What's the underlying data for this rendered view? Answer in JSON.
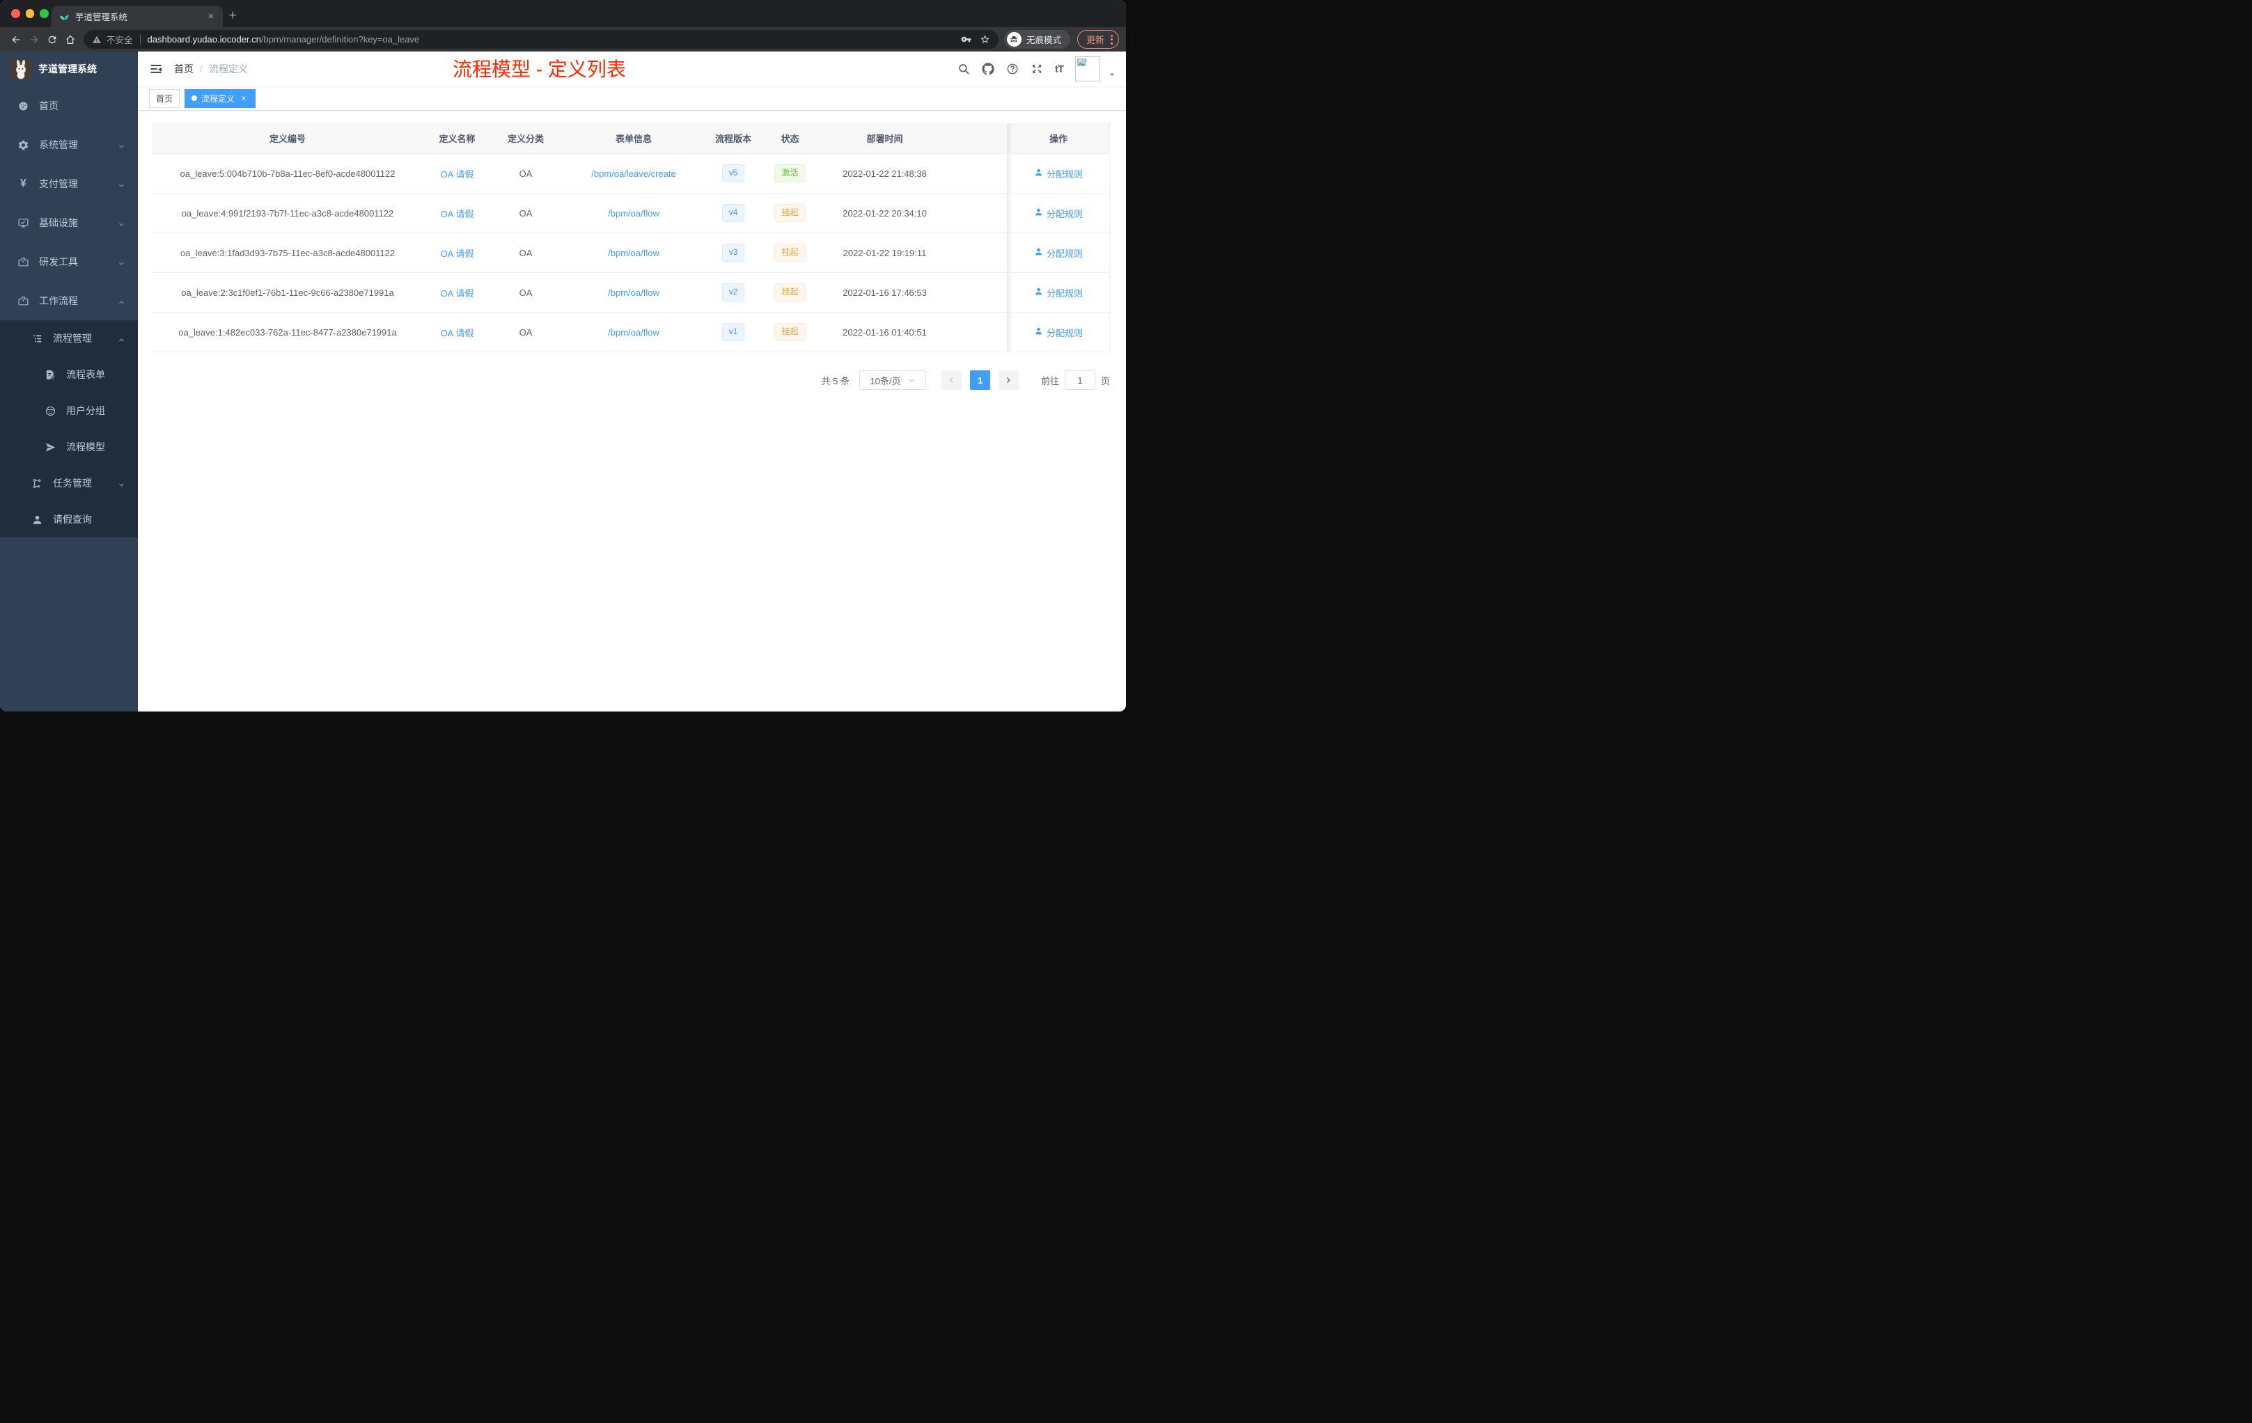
{
  "colors": {
    "accent": "#409eff",
    "annotation_red": "#ff2b00",
    "sidebar_bg": "#304156",
    "submenu_bg": "#1f2d3d",
    "status_active": {
      "bg": "#f0f9eb",
      "text": "#67c23a"
    },
    "status_suspended": {
      "bg": "#fdf6ec",
      "text": "#e6a23c"
    },
    "version_badge": {
      "bg": "#ecf5ff",
      "text": "#409eff"
    }
  },
  "glyphs": {
    "close": "×",
    "new_tab": "+",
    "breadcrumb_sep": "/",
    "font_size_icon": "tT"
  },
  "browser": {
    "tab_title": "芋道管理系统",
    "security_label": "不安全",
    "url_host": "dashboard.yudao.iocoder.cn",
    "url_path": "/bpm/manager/definition?key=oa_leave",
    "incognito_label": "无痕模式",
    "update_label": "更新"
  },
  "sidebar": {
    "logo_title": "芋道管理系统",
    "menu": [
      {
        "key": "home",
        "label": "首页",
        "icon": "dashboard-icon",
        "chevron": null,
        "level": 0
      },
      {
        "key": "system",
        "label": "系统管理",
        "icon": "gear-icon",
        "chevron": "down",
        "level": 0
      },
      {
        "key": "payment",
        "label": "支付管理",
        "icon": "yen-icon",
        "chevron": "down",
        "level": 0
      },
      {
        "key": "infra",
        "label": "基础设施",
        "icon": "monitor-icon",
        "chevron": "down",
        "level": 0
      },
      {
        "key": "devtools",
        "label": "研发工具",
        "icon": "toolbox-icon",
        "chevron": "down",
        "level": 0
      },
      {
        "key": "workflow",
        "label": "工作流程",
        "icon": "briefcase-icon",
        "chevron": "up",
        "level": 0
      }
    ],
    "submenu": [
      {
        "key": "process-mgmt",
        "label": "流程管理",
        "icon": "tree-list-icon",
        "chevron": "up",
        "level": 1
      },
      {
        "key": "process-form",
        "label": "流程表单",
        "icon": "form-icon",
        "chevron": null,
        "level": 2
      },
      {
        "key": "user-group",
        "label": "用户分组",
        "icon": "user-group-icon",
        "chevron": null,
        "level": 2
      },
      {
        "key": "process-model",
        "label": "流程模型",
        "icon": "paper-plane-icon",
        "chevron": null,
        "level": 2
      },
      {
        "key": "task-mgmt",
        "label": "任务管理",
        "icon": "flow-icon",
        "chevron": "down",
        "level": 1
      },
      {
        "key": "leave-query",
        "label": "请假查询",
        "icon": "person-icon",
        "chevron": null,
        "level": 1
      }
    ]
  },
  "header": {
    "breadcrumb": {
      "home": "首页",
      "current": "流程定义"
    },
    "annotation": "流程模型 - 定义列表"
  },
  "tags": [
    {
      "key": "home",
      "label": "首页",
      "active": false,
      "closable": false
    },
    {
      "key": "process-definition",
      "label": "流程定义",
      "active": true,
      "closable": true
    }
  ],
  "table": {
    "columns": [
      "定义编号",
      "定义名称",
      "定义分类",
      "表单信息",
      "流程版本",
      "状态",
      "部署时间",
      "操作"
    ],
    "action_label": "分配规则",
    "rows": [
      {
        "id": "oa_leave:5:004b710b-7b8a-11ec-8ef0-acde48001122",
        "name": "OA 请假",
        "category": "OA",
        "form": "/bpm/oa/leave/create",
        "version": "v5",
        "status": "激活",
        "status_type": "active",
        "deployed_at": "2022-01-22 21:48:38"
      },
      {
        "id": "oa_leave:4:991f2193-7b7f-11ec-a3c8-acde48001122",
        "name": "OA 请假",
        "category": "OA",
        "form": "/bpm/oa/flow",
        "version": "v4",
        "status": "挂起",
        "status_type": "suspended",
        "deployed_at": "2022-01-22 20:34:10"
      },
      {
        "id": "oa_leave:3:1fad3d93-7b75-11ec-a3c8-acde48001122",
        "name": "OA 请假",
        "category": "OA",
        "form": "/bpm/oa/flow",
        "version": "v3",
        "status": "挂起",
        "status_type": "suspended",
        "deployed_at": "2022-01-22 19:19:11"
      },
      {
        "id": "oa_leave:2:3c1f0ef1-76b1-11ec-9c66-a2380e71991a",
        "name": "OA 请假",
        "category": "OA",
        "form": "/bpm/oa/flow",
        "version": "v2",
        "status": "挂起",
        "status_type": "suspended",
        "deployed_at": "2022-01-16 17:46:53"
      },
      {
        "id": "oa_leave:1:482ec033-762a-11ec-8477-a2380e71991a",
        "name": "OA 请假",
        "category": "OA",
        "form": "/bpm/oa/flow",
        "version": "v1",
        "status": "挂起",
        "status_type": "suspended",
        "deployed_at": "2022-01-16 01:40:51"
      }
    ]
  },
  "pagination": {
    "total_label": "共 5 条",
    "page_size": "10条/页",
    "current_page": "1",
    "goto_label": "前往",
    "goto_value": "1",
    "page_unit": "页"
  }
}
